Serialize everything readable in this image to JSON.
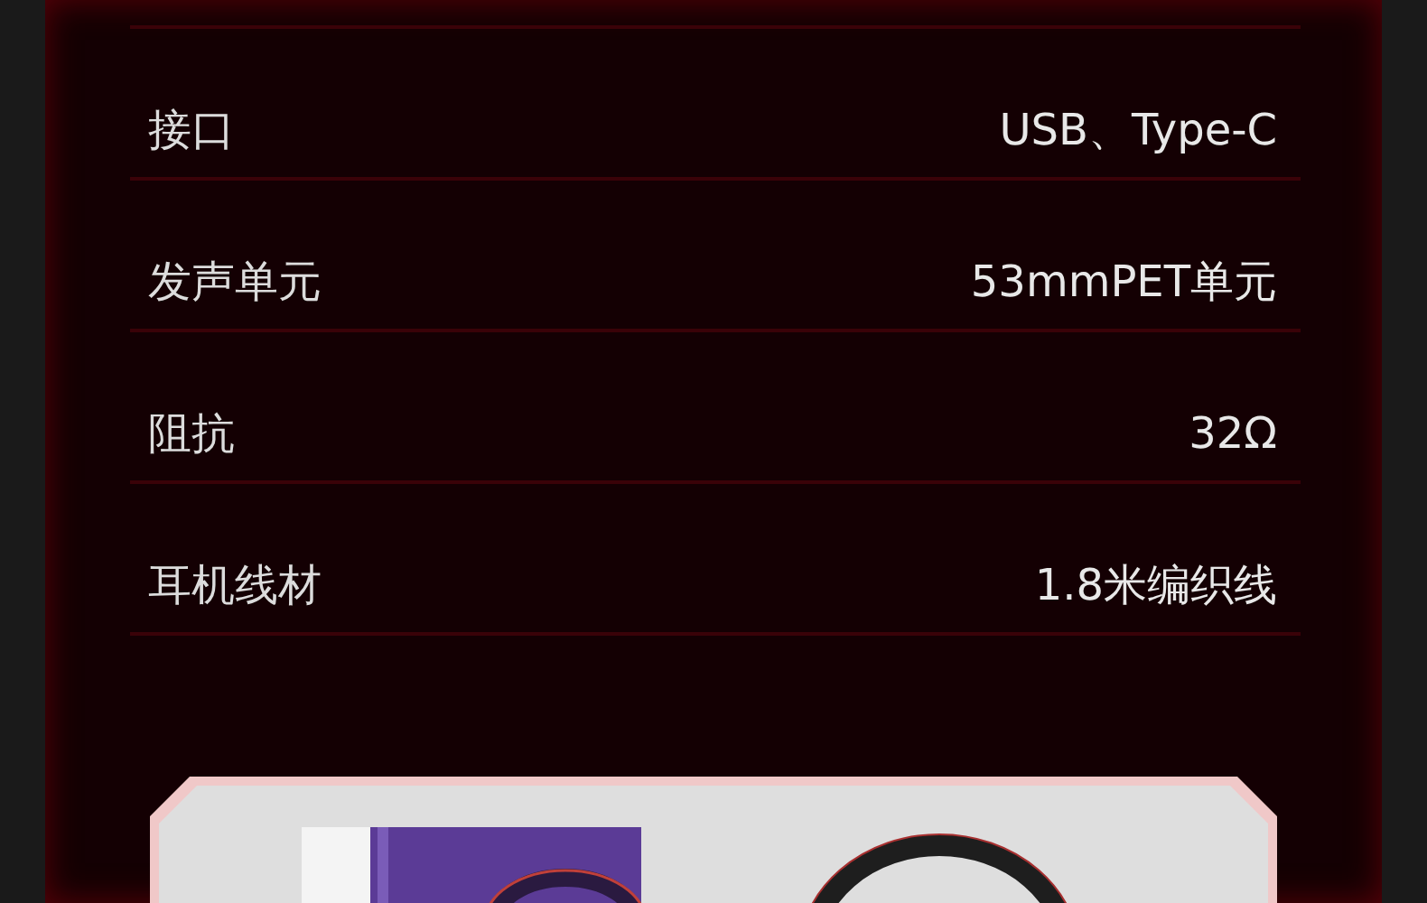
{
  "specs": [
    {
      "label": "接口",
      "value": "USB、Type-C"
    },
    {
      "label": "发声单元",
      "value": "53mmPET单元"
    },
    {
      "label": "阻抗",
      "value": "32Ω"
    },
    {
      "label": "耳机线材",
      "value": "1.8米编织线"
    }
  ]
}
